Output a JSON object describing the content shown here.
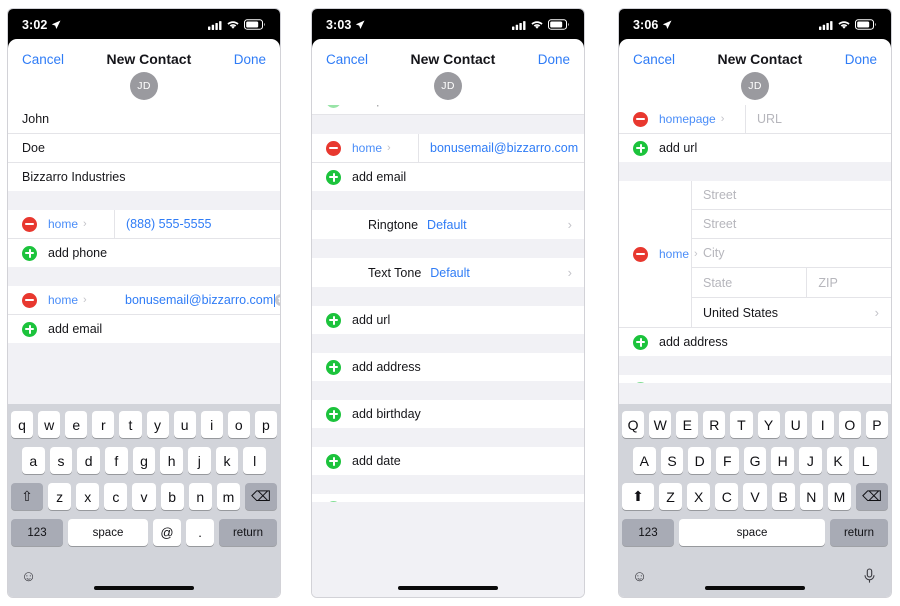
{
  "panels": [
    {
      "id": "panel-1",
      "status": {
        "time": "3:02",
        "location_icon": "location-arrow-icon",
        "cellular_icon": "cellular-bars-icon",
        "wifi_icon": "wifi-icon",
        "battery_icon": "battery-icon"
      },
      "nav": {
        "cancel": "Cancel",
        "title": "New Contact",
        "done": "Done"
      },
      "avatar": {
        "initials": "JD"
      },
      "fields": {
        "first_name": "John",
        "last_name": "Doe",
        "company": "Bizzarro Industries",
        "phone_label": "home",
        "phone_value": "(888) 555-5555",
        "add_phone": "add phone",
        "email_label": "home",
        "email_value": "bonusemail@bizzarro.com",
        "add_email": "add email"
      },
      "keyboard": {
        "row1": [
          "q",
          "w",
          "e",
          "r",
          "t",
          "y",
          "u",
          "i",
          "o",
          "p"
        ],
        "row2": [
          "a",
          "s",
          "d",
          "f",
          "g",
          "h",
          "j",
          "k",
          "l"
        ],
        "row3": [
          "z",
          "x",
          "c",
          "v",
          "b",
          "n",
          "m"
        ],
        "shift": "⇧",
        "backspace": "⌫",
        "numbers": "123",
        "space": "space",
        "at": "@",
        "period": ".",
        "return": "return",
        "emoji": "☺",
        "mic": null
      }
    },
    {
      "id": "panel-2",
      "status": {
        "time": "3:03",
        "location_icon": "location-arrow-icon",
        "cellular_icon": "cellular-bars-icon",
        "wifi_icon": "wifi-icon",
        "battery_icon": "battery-icon"
      },
      "nav": {
        "cancel": "Cancel",
        "title": "New Contact",
        "done": "Done"
      },
      "avatar": {
        "initials": "JD"
      },
      "fields": {
        "add_phone": "add phone",
        "email_label": "home",
        "email_value": "bonusemail@bizzarro.com",
        "add_email": "add email",
        "ringtone_key": "Ringtone",
        "ringtone_value": "Default",
        "texttone_key": "Text Tone",
        "texttone_value": "Default",
        "add_url": "add url",
        "add_address": "add address",
        "add_birthday": "add birthday",
        "add_date": "add date"
      }
    },
    {
      "id": "panel-3",
      "status": {
        "time": "3:06",
        "location_icon": "location-arrow-icon",
        "cellular_icon": "cellular-bars-icon",
        "wifi_icon": "wifi-icon",
        "battery_icon": "battery-icon"
      },
      "nav": {
        "cancel": "Cancel",
        "title": "New Contact",
        "done": "Done"
      },
      "avatar": {
        "initials": "JD"
      },
      "fields": {
        "url_label": "homepage",
        "url_placeholder": "URL",
        "add_url": "add url",
        "address_label": "home",
        "street1": "Street",
        "street2": "Street",
        "city": "City",
        "state": "State",
        "zip": "ZIP",
        "country": "United States",
        "add_address": "add address"
      },
      "keyboard": {
        "row1": [
          "Q",
          "W",
          "E",
          "R",
          "T",
          "Y",
          "U",
          "I",
          "O",
          "P"
        ],
        "row2": [
          "A",
          "S",
          "D",
          "F",
          "G",
          "H",
          "J",
          "K",
          "L"
        ],
        "row3": [
          "Z",
          "X",
          "C",
          "V",
          "B",
          "N",
          "M"
        ],
        "shift": "⬆",
        "backspace": "⌫",
        "numbers": "123",
        "space": "space",
        "return": "return",
        "emoji": "☺",
        "mic": "🎤"
      }
    }
  ],
  "colors": {
    "accent_blue": "#2f7cf6",
    "link_blue": "#4a8df8",
    "minus_red": "#e8382f",
    "plus_green": "#1cc33c",
    "group_bg": "#f1f1f5",
    "keyboard_bg": "#d2d4da"
  }
}
